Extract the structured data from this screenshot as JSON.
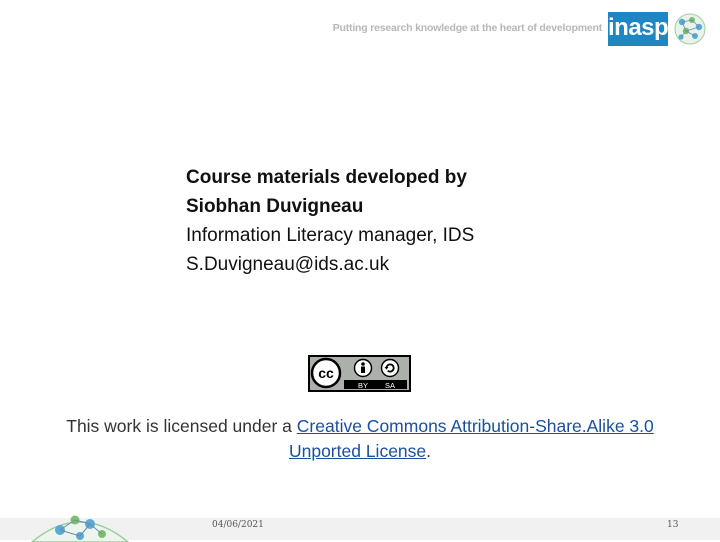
{
  "header": {
    "tagline": "Putting research knowledge at the heart of development",
    "logo_text": "inasp"
  },
  "credits": {
    "line1": "Course materials developed by",
    "line2": "Siobhan Duvigneau",
    "line3": "Information Literacy manager, IDS",
    "line4": "S.Duvigneau@ids.ac.uk"
  },
  "cc_badge": {
    "label_cc": "cc",
    "label_by": "BY",
    "label_sa": "SA"
  },
  "license": {
    "prefix": "This work is licensed under a ",
    "link_text": "Creative Commons Attribution-Share.Alike 3.0 Unported License",
    "suffix": "."
  },
  "footer": {
    "date": "04/06/2021",
    "page_number": "13"
  },
  "colors": {
    "brand_blue": "#1e86c3",
    "link_blue": "#1a4f9e",
    "footer_band": "#f1f1f1"
  }
}
